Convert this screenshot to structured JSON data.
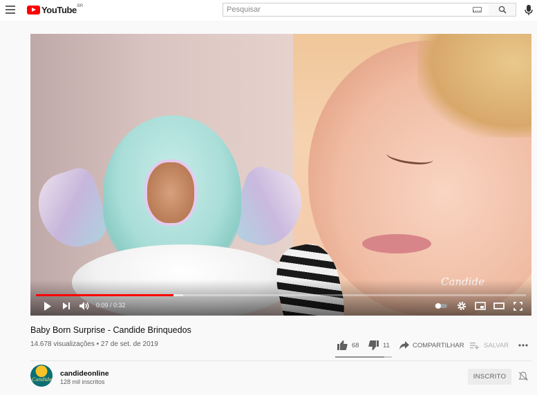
{
  "header": {
    "logo_text": "YouTube",
    "region": "BR",
    "search_placeholder": "Pesquisar"
  },
  "player": {
    "watermark": "Candide",
    "time": "0:09 / 0:32",
    "progress": 0.28,
    "buffered": 0.3
  },
  "video": {
    "title": "Baby Born Surprise - Candide Brinquedos",
    "views": "14.678 visualizações",
    "date": "27 de set. de 2019",
    "likes": "68",
    "dislikes": "11",
    "share_label": "COMPARTILHAR",
    "save_label": "SALVAR",
    "like_ratio": 0.86
  },
  "channel": {
    "name": "candideonline",
    "subscribers": "128 mil inscritos",
    "subscribe_label": "INSCRITO",
    "avatar_text": "Candide"
  },
  "colors": {
    "brand": "#ff0000",
    "progress": "#ff0000"
  }
}
